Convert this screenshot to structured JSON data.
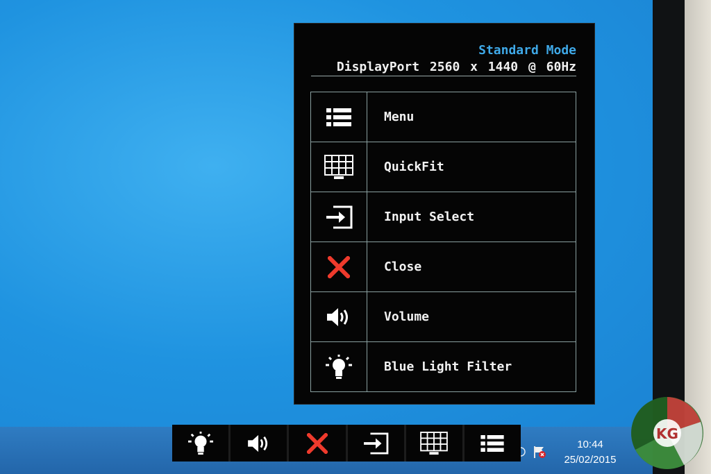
{
  "osd": {
    "mode": "Standard Mode",
    "signal": "DisplayPort 2560 x 1440 @ 60Hz",
    "items": [
      {
        "label": "Menu",
        "icon": "menu-list-icon"
      },
      {
        "label": "QuickFit",
        "icon": "quickfit-grid-icon"
      },
      {
        "label": "Input Select",
        "icon": "input-select-icon"
      },
      {
        "label": "Close",
        "icon": "close-x-icon"
      },
      {
        "label": "Volume",
        "icon": "volume-speaker-icon"
      },
      {
        "label": "Blue Light Filter",
        "icon": "blue-light-bulb-icon"
      }
    ]
  },
  "quickbar": {
    "buttons": [
      "blue-light-bulb-icon",
      "volume-speaker-icon",
      "close-x-icon",
      "input-select-icon",
      "quickfit-grid-icon",
      "menu-list-icon"
    ]
  },
  "taskbar": {
    "time": "10:44",
    "date": "25/02/2015"
  },
  "logo": {
    "text": "KG"
  },
  "colors": {
    "mode_text": "#3fa9e8",
    "close_red": "#ee3a2c",
    "desktop_blue": "#1f93e0"
  }
}
